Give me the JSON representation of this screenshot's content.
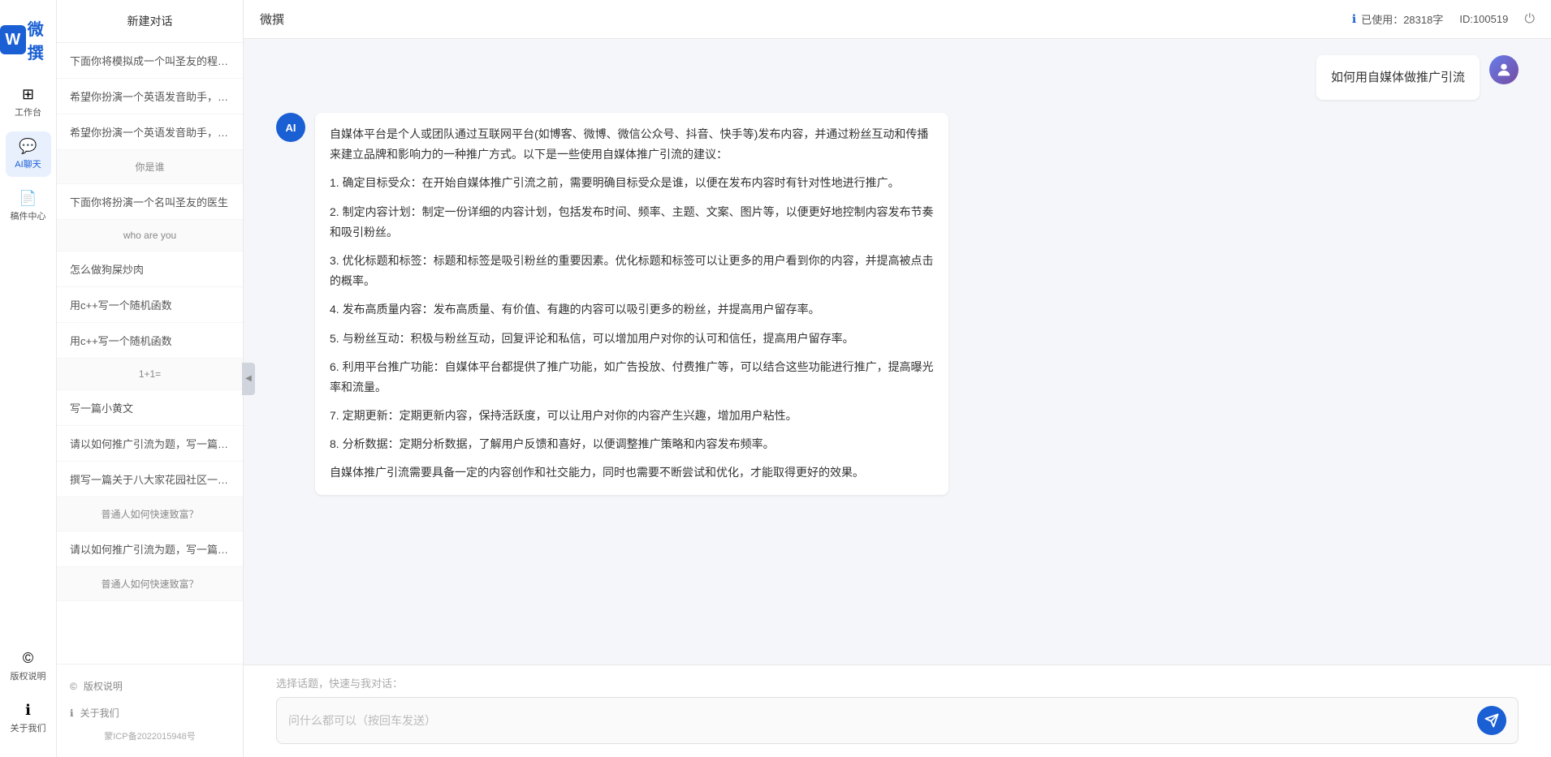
{
  "app": {
    "title": "微撰",
    "logo_letter": "W"
  },
  "topbar": {
    "title": "微撰",
    "usage_label": "已使用：28318字",
    "id_label": "ID:100519",
    "usage_icon": "ℹ"
  },
  "nav": {
    "items": [
      {
        "id": "workbench",
        "icon": "⊞",
        "label": "工作台"
      },
      {
        "id": "ai-chat",
        "icon": "💬",
        "label": "AI聊天"
      },
      {
        "id": "drafts",
        "icon": "📄",
        "label": "稿件中心"
      }
    ],
    "bottom_items": [
      {
        "id": "copyright",
        "icon": "©",
        "label": "版权说明"
      },
      {
        "id": "about",
        "icon": "ℹ",
        "label": "关于我们"
      }
    ]
  },
  "sidebar": {
    "new_chat": "新建对话",
    "items": [
      "下面你将模拟成一个叫圣友的程序员，我说...",
      "希望你扮演一个英语发音助手，我提供给你...",
      "希望你扮演一个英语发音助手，我提供给你...",
      "你是谁",
      "下面你将扮演一个名叫圣友的医生",
      "who are you",
      "怎么做狗屎炒肉",
      "用c++写一个随机函数",
      "用c++写一个随机函数",
      "1+1=",
      "写一篇小黄文",
      "请以如何推广引流为题，写一篇大纲",
      "撰写一篇关于八大家花园社区一刻钟便民生...",
      "普通人如何快速致富？",
      "请以如何推广引流为题，写一篇大纲",
      "普通人如何快速致富？"
    ],
    "footer": {
      "copyright": "版权说明",
      "about": "关于我们",
      "icp": "蒙ICP备2022015948号"
    }
  },
  "chat": {
    "user_message": "如何用自媒体做推广引流",
    "ai_response": {
      "paragraphs": [
        "自媒体平台是个人或团队通过互联网平台(如博客、微博、微信公众号、抖音、快手等)发布内容，并通过粉丝互动和传播来建立品牌和影响力的一种推广方式。以下是一些使用自媒体推广引流的建议：",
        "1. 确定目标受众：在开始自媒体推广引流之前，需要明确目标受众是谁，以便在发布内容时有针对性地进行推广。",
        "2. 制定内容计划：制定一份详细的内容计划，包括发布时间、频率、主题、文案、图片等，以便更好地控制内容发布节奏和吸引粉丝。",
        "3. 优化标题和标签：标题和标签是吸引粉丝的重要因素。优化标题和标签可以让更多的用户看到你的内容，并提高被点击的概率。",
        "4. 发布高质量内容：发布高质量、有价值、有趣的内容可以吸引更多的粉丝，并提高用户留存率。",
        "5. 与粉丝互动：积极与粉丝互动，回复评论和私信，可以增加用户对你的认可和信任，提高用户留存率。",
        "6. 利用平台推广功能：自媒体平台都提供了推广功能，如广告投放、付费推广等，可以结合这些功能进行推广，提高曝光率和流量。",
        "7. 定期更新：定期更新内容，保持活跃度，可以让用户对你的内容产生兴趣，增加用户粘性。",
        "8. 分析数据：定期分析数据，了解用户反馈和喜好，以便调整推广策略和内容发布频率。",
        "自媒体推广引流需要具备一定的内容创作和社交能力，同时也需要不断尝试和优化，才能取得更好的效果。"
      ]
    }
  },
  "input": {
    "topic_hint": "选择话题，快速与我对话：",
    "placeholder": "问什么都可以（按回车发送）"
  }
}
